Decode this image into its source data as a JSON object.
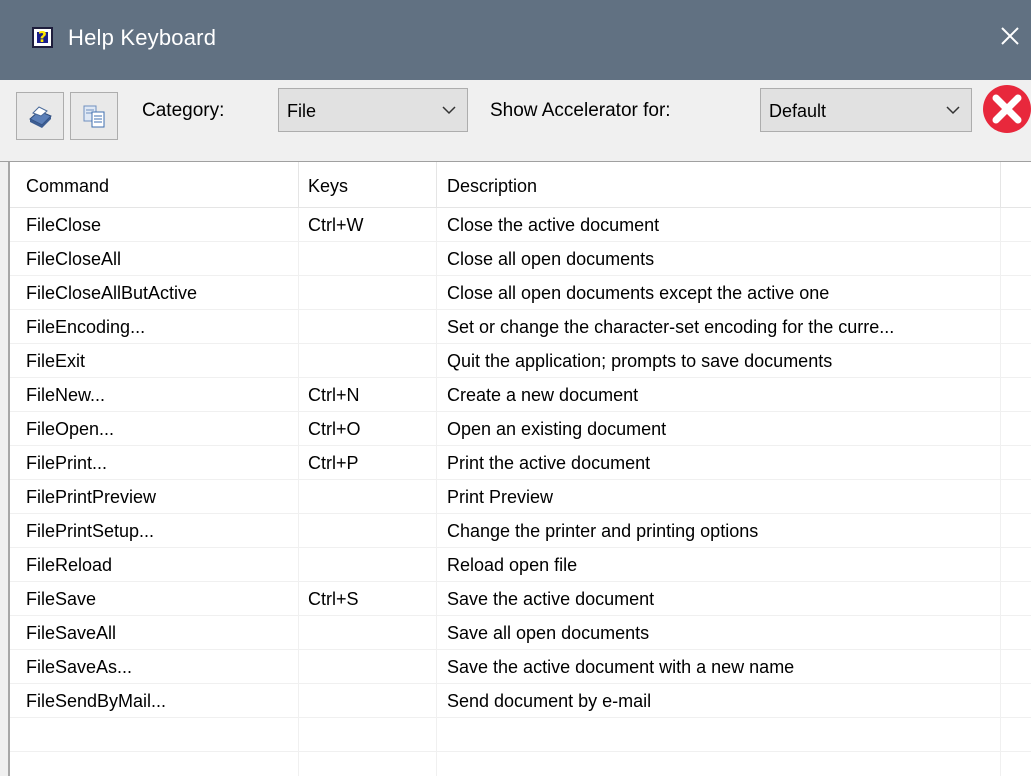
{
  "window": {
    "title": "Help Keyboard",
    "icon": "help-question-icon",
    "close_glyph": "✕"
  },
  "toolbar": {
    "print_icon": "print-icon",
    "copy_icon": "copy-icon",
    "category_label": "Category:",
    "category_value": "File",
    "accelerator_label": "Show Accelerator for:",
    "accelerator_value": "Default",
    "cancel_icon": "cancel-x-icon"
  },
  "table": {
    "columns": [
      "Command",
      "Keys",
      "Description"
    ],
    "rows": [
      {
        "command": "FileClose",
        "keys": "Ctrl+W",
        "description": "Close the active document"
      },
      {
        "command": "FileCloseAll",
        "keys": "",
        "description": "Close all open documents"
      },
      {
        "command": "FileCloseAllButActive",
        "keys": "",
        "description": "Close all open documents except the active one"
      },
      {
        "command": "FileEncoding...",
        "keys": "",
        "description": "Set or change the character-set encoding for the curre..."
      },
      {
        "command": "FileExit",
        "keys": "",
        "description": "Quit the application; prompts to save documents"
      },
      {
        "command": "FileNew...",
        "keys": "Ctrl+N",
        "description": "Create a new document"
      },
      {
        "command": "FileOpen...",
        "keys": "Ctrl+O",
        "description": "Open an existing document"
      },
      {
        "command": "FilePrint...",
        "keys": "Ctrl+P",
        "description": "Print the active document"
      },
      {
        "command": "FilePrintPreview",
        "keys": "",
        "description": "Print Preview"
      },
      {
        "command": "FilePrintSetup...",
        "keys": "",
        "description": "Change the printer and printing options"
      },
      {
        "command": "FileReload",
        "keys": "",
        "description": "Reload open file"
      },
      {
        "command": "FileSave",
        "keys": "Ctrl+S",
        "description": "Save the active document"
      },
      {
        "command": "FileSaveAll",
        "keys": "",
        "description": "Save all open documents"
      },
      {
        "command": "FileSaveAs...",
        "keys": "",
        "description": "Save the active document with a new name"
      },
      {
        "command": "FileSendByMail...",
        "keys": "",
        "description": "Send document by e-mail"
      }
    ]
  },
  "colors": {
    "titlebar": "#617182",
    "cancel_red": "#e8283c"
  }
}
